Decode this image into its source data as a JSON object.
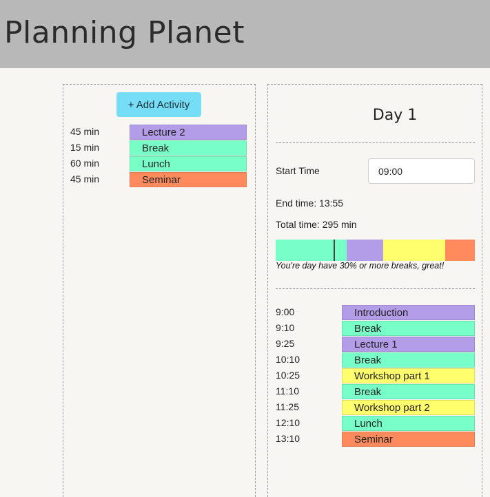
{
  "header": {
    "title": "Planning Planet"
  },
  "activities_panel": {
    "add_button_label": "+ Add Activity",
    "items": [
      {
        "duration": "45 min",
        "name": "Lecture 2",
        "color": "#b39ce8"
      },
      {
        "duration": "15 min",
        "name": "Break",
        "color": "#78ffc8"
      },
      {
        "duration": "60 min",
        "name": "Lunch",
        "color": "#78ffc8"
      },
      {
        "duration": "45 min",
        "name": "Seminar",
        "color": "#ff8a5e"
      }
    ]
  },
  "day_panel": {
    "title": "Day 1",
    "start_time_label": "Start Time",
    "start_time_value": "09:00",
    "end_time_text": "End time: 13:55",
    "total_time_text": "Total time: 295 min",
    "break_message": "You're day have 30% or more breaks, great!",
    "distribution": [
      {
        "color": "#78ffc8",
        "fraction": 0.355
      },
      {
        "color": "#b39ce8",
        "fraction": 0.185
      },
      {
        "color": "#ffff6e",
        "fraction": 0.31
      },
      {
        "color": "#ff8a5e",
        "fraction": 0.15
      }
    ],
    "marker_fraction": 0.29,
    "schedule": [
      {
        "time": "9:00",
        "name": "Introduction",
        "color": "#b39ce8"
      },
      {
        "time": "9:10",
        "name": "Break",
        "color": "#78ffc8"
      },
      {
        "time": "9:25",
        "name": "Lecture 1",
        "color": "#b39ce8"
      },
      {
        "time": "10:10",
        "name": "Break",
        "color": "#78ffc8"
      },
      {
        "time": "10:25",
        "name": "Workshop part 1",
        "color": "#ffff6e"
      },
      {
        "time": "11:10",
        "name": "Break",
        "color": "#78ffc8"
      },
      {
        "time": "11:25",
        "name": "Workshop part 2",
        "color": "#ffff6e"
      },
      {
        "time": "12:10",
        "name": "Lunch",
        "color": "#78ffc8"
      },
      {
        "time": "13:10",
        "name": "Seminar",
        "color": "#ff8a5e"
      }
    ]
  }
}
